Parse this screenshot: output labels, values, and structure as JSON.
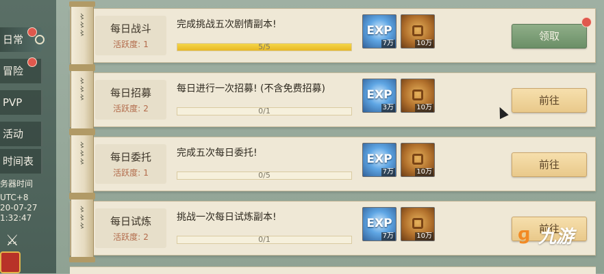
{
  "sidebar": {
    "tabs": [
      {
        "label": "日常",
        "active": true,
        "badge": true
      },
      {
        "label": "冒险",
        "active": false,
        "badge": true
      },
      {
        "label": "PVP",
        "active": false,
        "badge": false
      },
      {
        "label": "活动",
        "active": false,
        "badge": false
      },
      {
        "label": "时间表",
        "active": false,
        "badge": false
      }
    ],
    "server": {
      "label": "务器时间",
      "timezone": "UTC+8",
      "date": "20-07-27",
      "time": "1:32:47"
    }
  },
  "quests": [
    {
      "name": "每日战斗",
      "activity_label": "活跃度:",
      "activity_value": "1",
      "description": "完成挑战五次剧情副本!",
      "progress_text": "5/5",
      "progress_fraction": 1.0,
      "exp_label": "EXP",
      "exp_qty": "7万",
      "coin_qty": "10万",
      "button_label": "领取",
      "button_style": "claim",
      "badge": true
    },
    {
      "name": "每日招募",
      "activity_label": "活跃度:",
      "activity_value": "2",
      "description": "每日进行一次招募! (不含免费招募)",
      "progress_text": "0/1",
      "progress_fraction": 0.0,
      "exp_label": "EXP",
      "exp_qty": "3万",
      "coin_qty": "10万",
      "button_label": "前往",
      "button_style": "go",
      "badge": false
    },
    {
      "name": "每日委托",
      "activity_label": "活跃度:",
      "activity_value": "1",
      "description": "完成五次每日委托!",
      "progress_text": "0/5",
      "progress_fraction": 0.0,
      "exp_label": "EXP",
      "exp_qty": "7万",
      "coin_qty": "10万",
      "button_label": "前往",
      "button_style": "go",
      "badge": false
    },
    {
      "name": "每日试炼",
      "activity_label": "活跃度:",
      "activity_value": "2",
      "description": "挑战一次每日试炼副本!",
      "progress_text": "0/1",
      "progress_fraction": 0.0,
      "exp_label": "EXP",
      "exp_qty": "7万",
      "coin_qty": "10万",
      "button_label": "前往",
      "button_style": "go",
      "badge": false
    }
  ],
  "watermark": {
    "text": "九游"
  },
  "colors": {
    "panel_bg": "#efe8d6",
    "progress_fill": "#e8b723",
    "claim_button": "#6b8f67",
    "go_button": "#e9c98b",
    "badge_red": "#e0584d"
  }
}
